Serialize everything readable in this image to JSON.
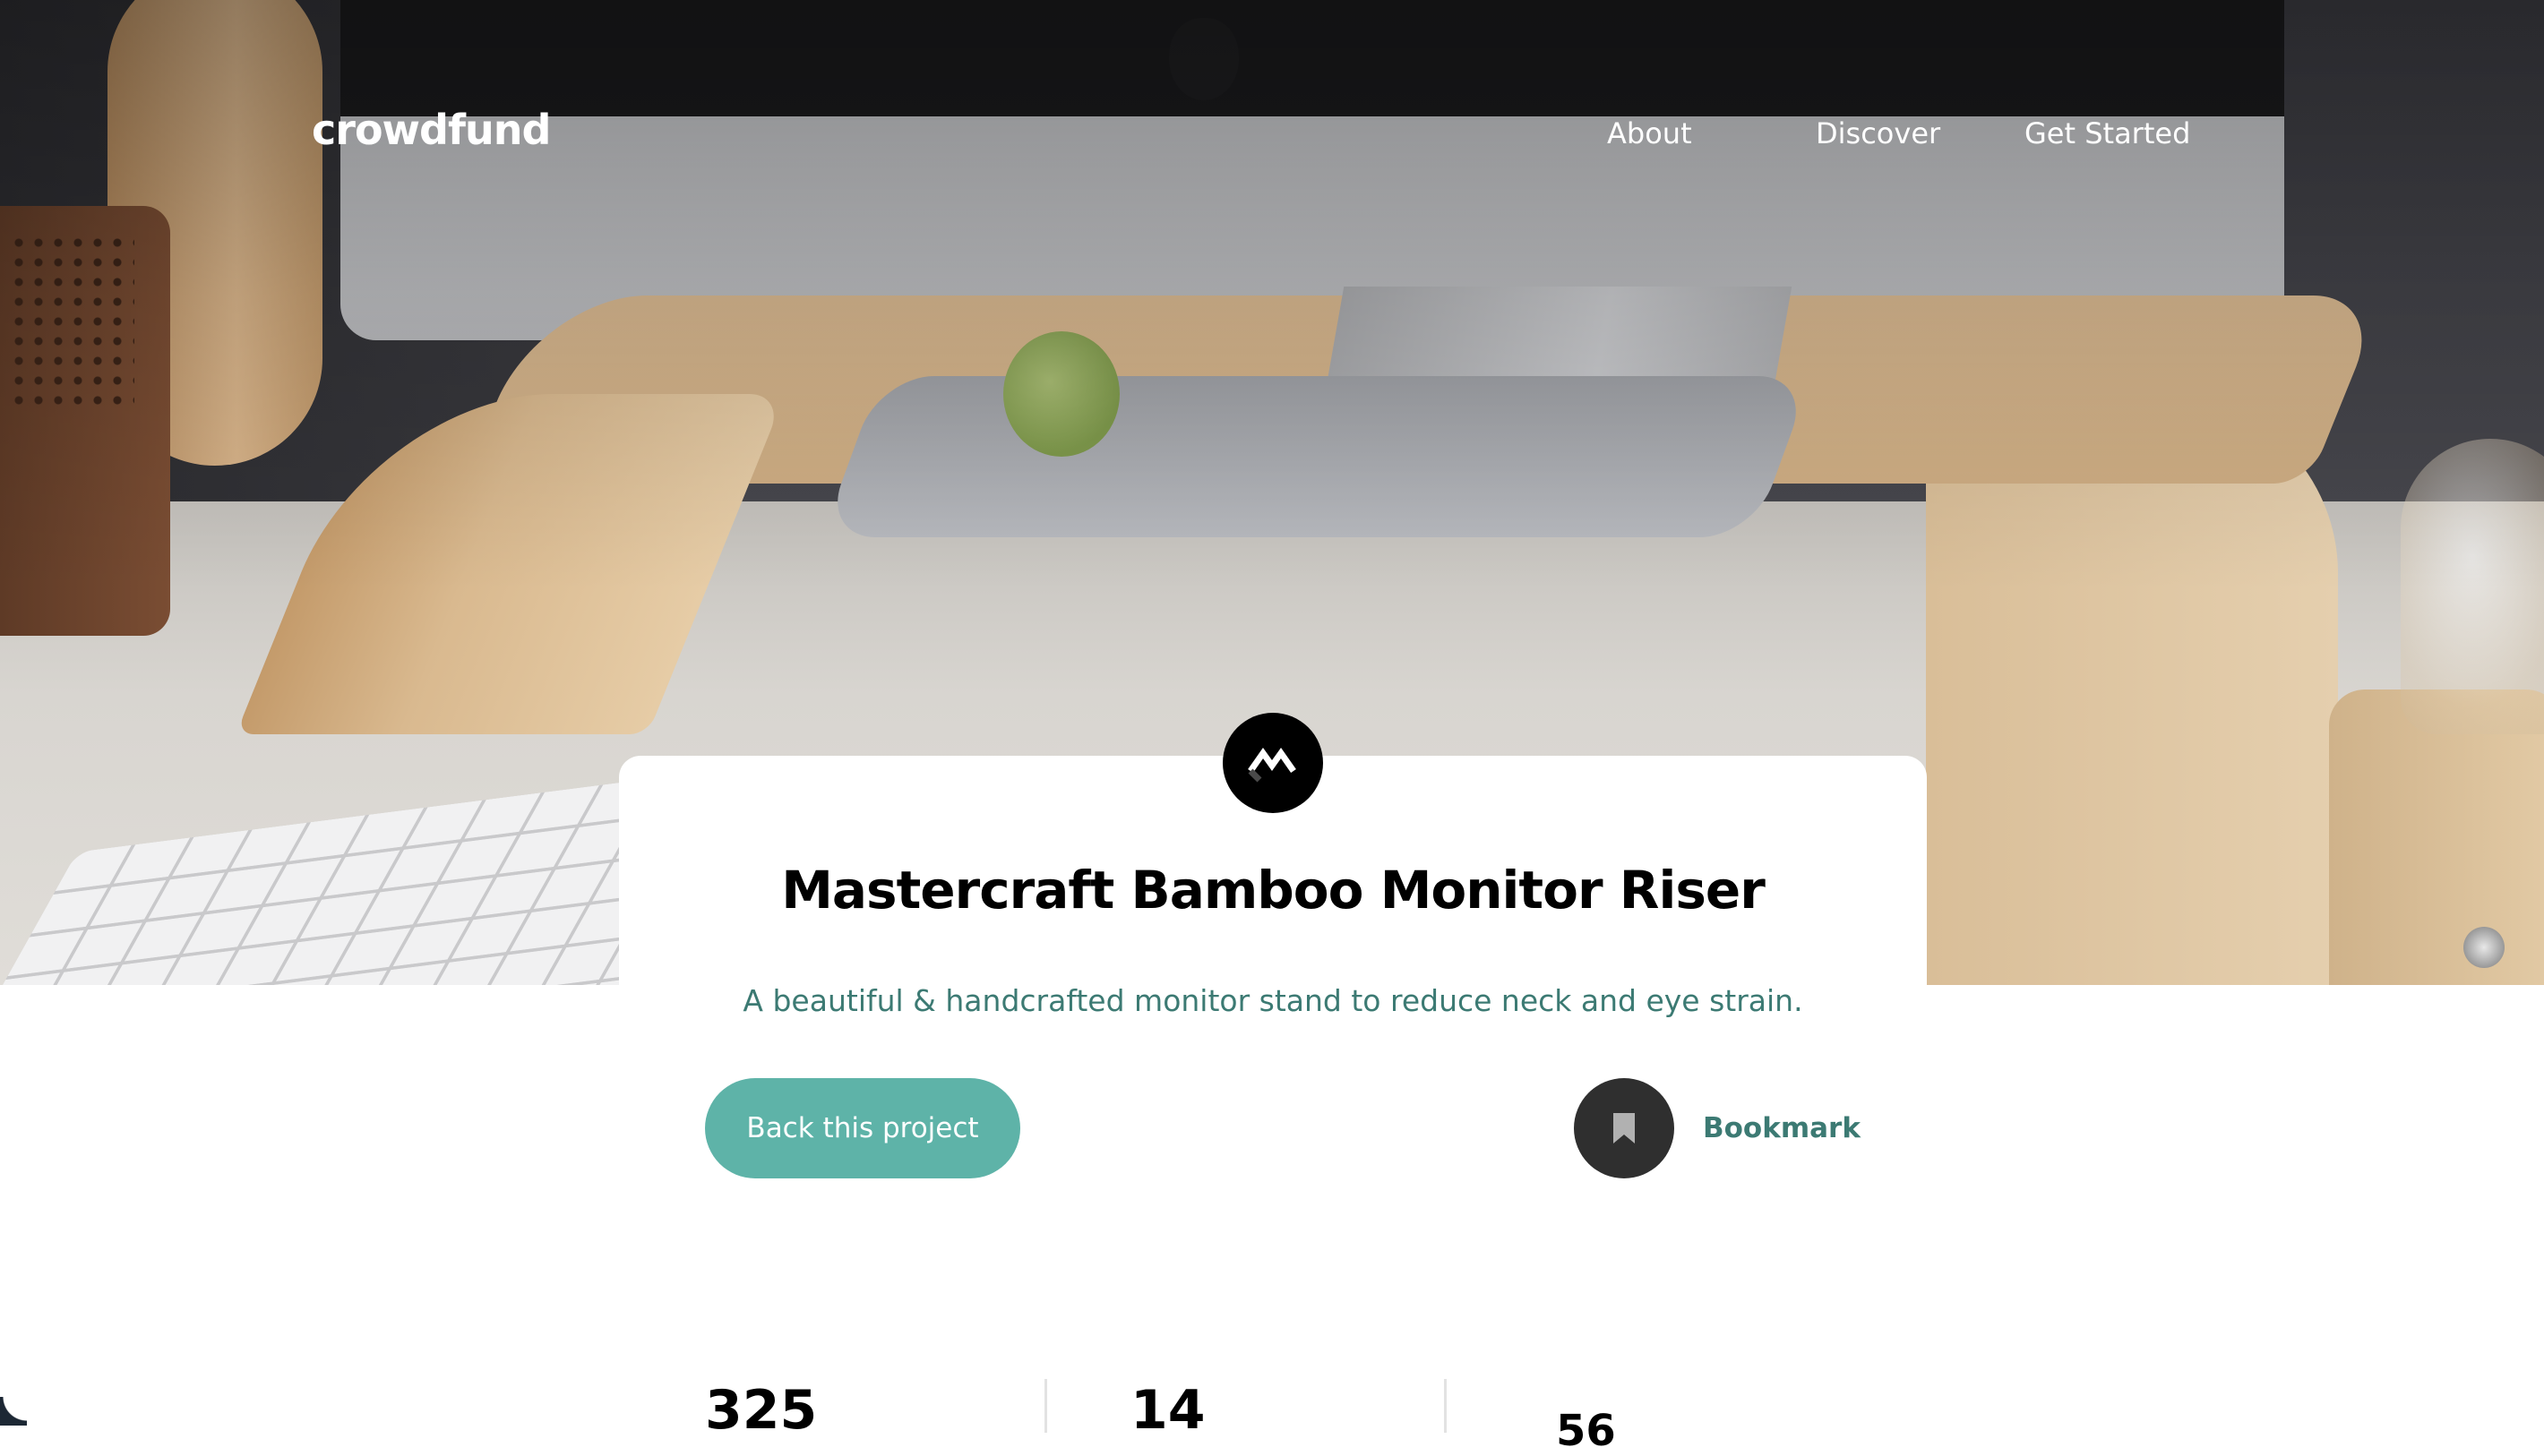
{
  "brand": {
    "logo_text": "crowdfund"
  },
  "nav": {
    "items": [
      {
        "label": "About"
      },
      {
        "label": "Discover"
      },
      {
        "label": "Get Started"
      }
    ]
  },
  "hero": {
    "image_alt": "desk with monitor on bamboo riser"
  },
  "project": {
    "logo_icon": "mastercraft-logo-icon",
    "title": "Mastercraft Bamboo Monitor Riser",
    "subtitle": "A beautiful & handcrafted monitor stand to reduce neck and eye strain.",
    "back_label": "Back this project",
    "bookmark_label": "Bookmark",
    "bookmark_icon": "bookmark-icon"
  },
  "stats": [
    {
      "value": "325"
    },
    {
      "value": "14"
    },
    {
      "value": "56"
    }
  ],
  "colors": {
    "accent": "#5eb3a8",
    "accent_dark": "#3c7a73",
    "bookmark_circle": "#2f2f2f"
  }
}
